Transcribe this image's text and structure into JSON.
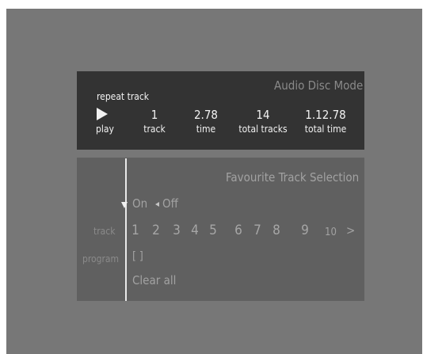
{
  "status": {
    "mode_title": "Audio Disc Mode",
    "repeat_label": "repeat track",
    "play_label": "play",
    "track_value": "1",
    "track_label": "track",
    "time_value": "2.78",
    "time_label": "time",
    "total_tracks_value": "14",
    "total_tracks_label": "total tracks",
    "total_time_value": "1.12.78",
    "total_time_label": "total time",
    "play_icon": "play-triangle-icon"
  },
  "favourite": {
    "title": "Favourite Track Selection",
    "on_label": "On",
    "off_label": "Off",
    "selected": "On",
    "track_row_label": "track",
    "tracks": [
      "1",
      "2",
      "3",
      "4",
      "5",
      "6",
      "7",
      "8",
      "9",
      "10"
    ],
    "next_arrow": ">",
    "program_row_label": "program",
    "program_value": "[ ]",
    "clear_all_label": "Clear all"
  },
  "colors": {
    "background": "#777777",
    "status_panel": "#333333",
    "favourite_panel": "#606060",
    "active_text": "#f2f2f2",
    "inactive_text": "#a2a2a2"
  }
}
